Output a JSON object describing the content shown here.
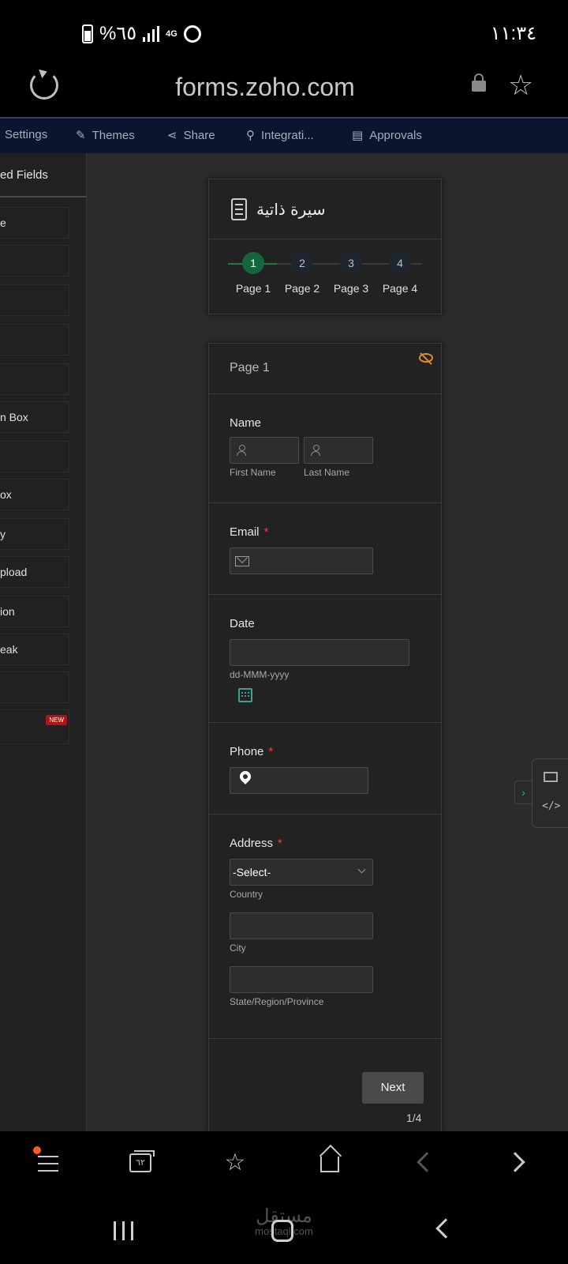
{
  "status": {
    "battery": "%٦٥",
    "network": "4G",
    "time": "١١:٣٤"
  },
  "browser": {
    "url": "forms.zoho.com"
  },
  "nav": {
    "settings": "Settings",
    "themes": "Themes",
    "share": "Share",
    "integrations": "Integrati...",
    "approvals": "Approvals"
  },
  "left_panel": {
    "header": "ed Fields",
    "items": [
      "e",
      "",
      "",
      "",
      "",
      "n Box",
      "",
      "ox",
      "y",
      "pload",
      "ion",
      "eak",
      "",
      ""
    ],
    "new_badge": "NEW"
  },
  "form": {
    "title": "سيرة ذاتية",
    "steps": [
      {
        "num": "1",
        "label": "Page 1"
      },
      {
        "num": "2",
        "label": "Page 2"
      },
      {
        "num": "3",
        "label": "Page 3"
      },
      {
        "num": "4",
        "label": "Page 4"
      }
    ],
    "page_name": "Page 1",
    "name_label": "Name",
    "first_name": "First Name",
    "last_name": "Last Name",
    "email_label": "Email",
    "required_mark": "*",
    "date_label": "Date",
    "date_format": "dd-MMM-yyyy",
    "phone_label": "Phone",
    "address_label": "Address",
    "select_placeholder": "-Select-",
    "country": "Country",
    "city": "City",
    "state": "State/Region/Province",
    "next": "Next",
    "pager": "1/4"
  },
  "bottom_bar": {
    "tabs_count": "٦٢"
  },
  "watermark": {
    "arabic": "مستقل",
    "latin": "mostaql.com"
  }
}
